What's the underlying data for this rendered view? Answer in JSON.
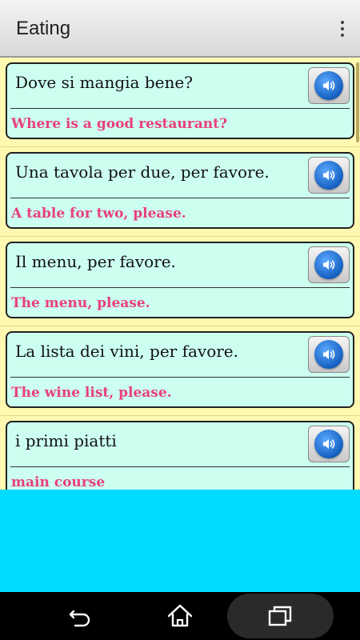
{
  "action_bar": {
    "title": "Eating",
    "overflow_icon": "more-vert-icon"
  },
  "phrases": [
    {
      "phrase": "Dove si mangia bene?",
      "translation": "Where is a good restaurant?"
    },
    {
      "phrase": "Una tavola per due, per favore.",
      "translation": "A table for two, please."
    },
    {
      "phrase": "Il menu, per favore.",
      "translation": "The menu, please."
    },
    {
      "phrase": "La lista dei vini, per favore.",
      "translation": "The wine list, please."
    },
    {
      "phrase": "i primi piatti",
      "translation": "main course"
    }
  ],
  "speak_icon": "speaker-icon",
  "nav": {
    "back_icon": "back-icon",
    "home_icon": "home-icon",
    "recents_icon": "recent-apps-icon"
  },
  "colors": {
    "list_background": "#fff8b0",
    "card_background": "#ccfff0",
    "translation_text": "#e8407a",
    "ad_area": "#00dcff",
    "nav_bar": "#000000"
  }
}
